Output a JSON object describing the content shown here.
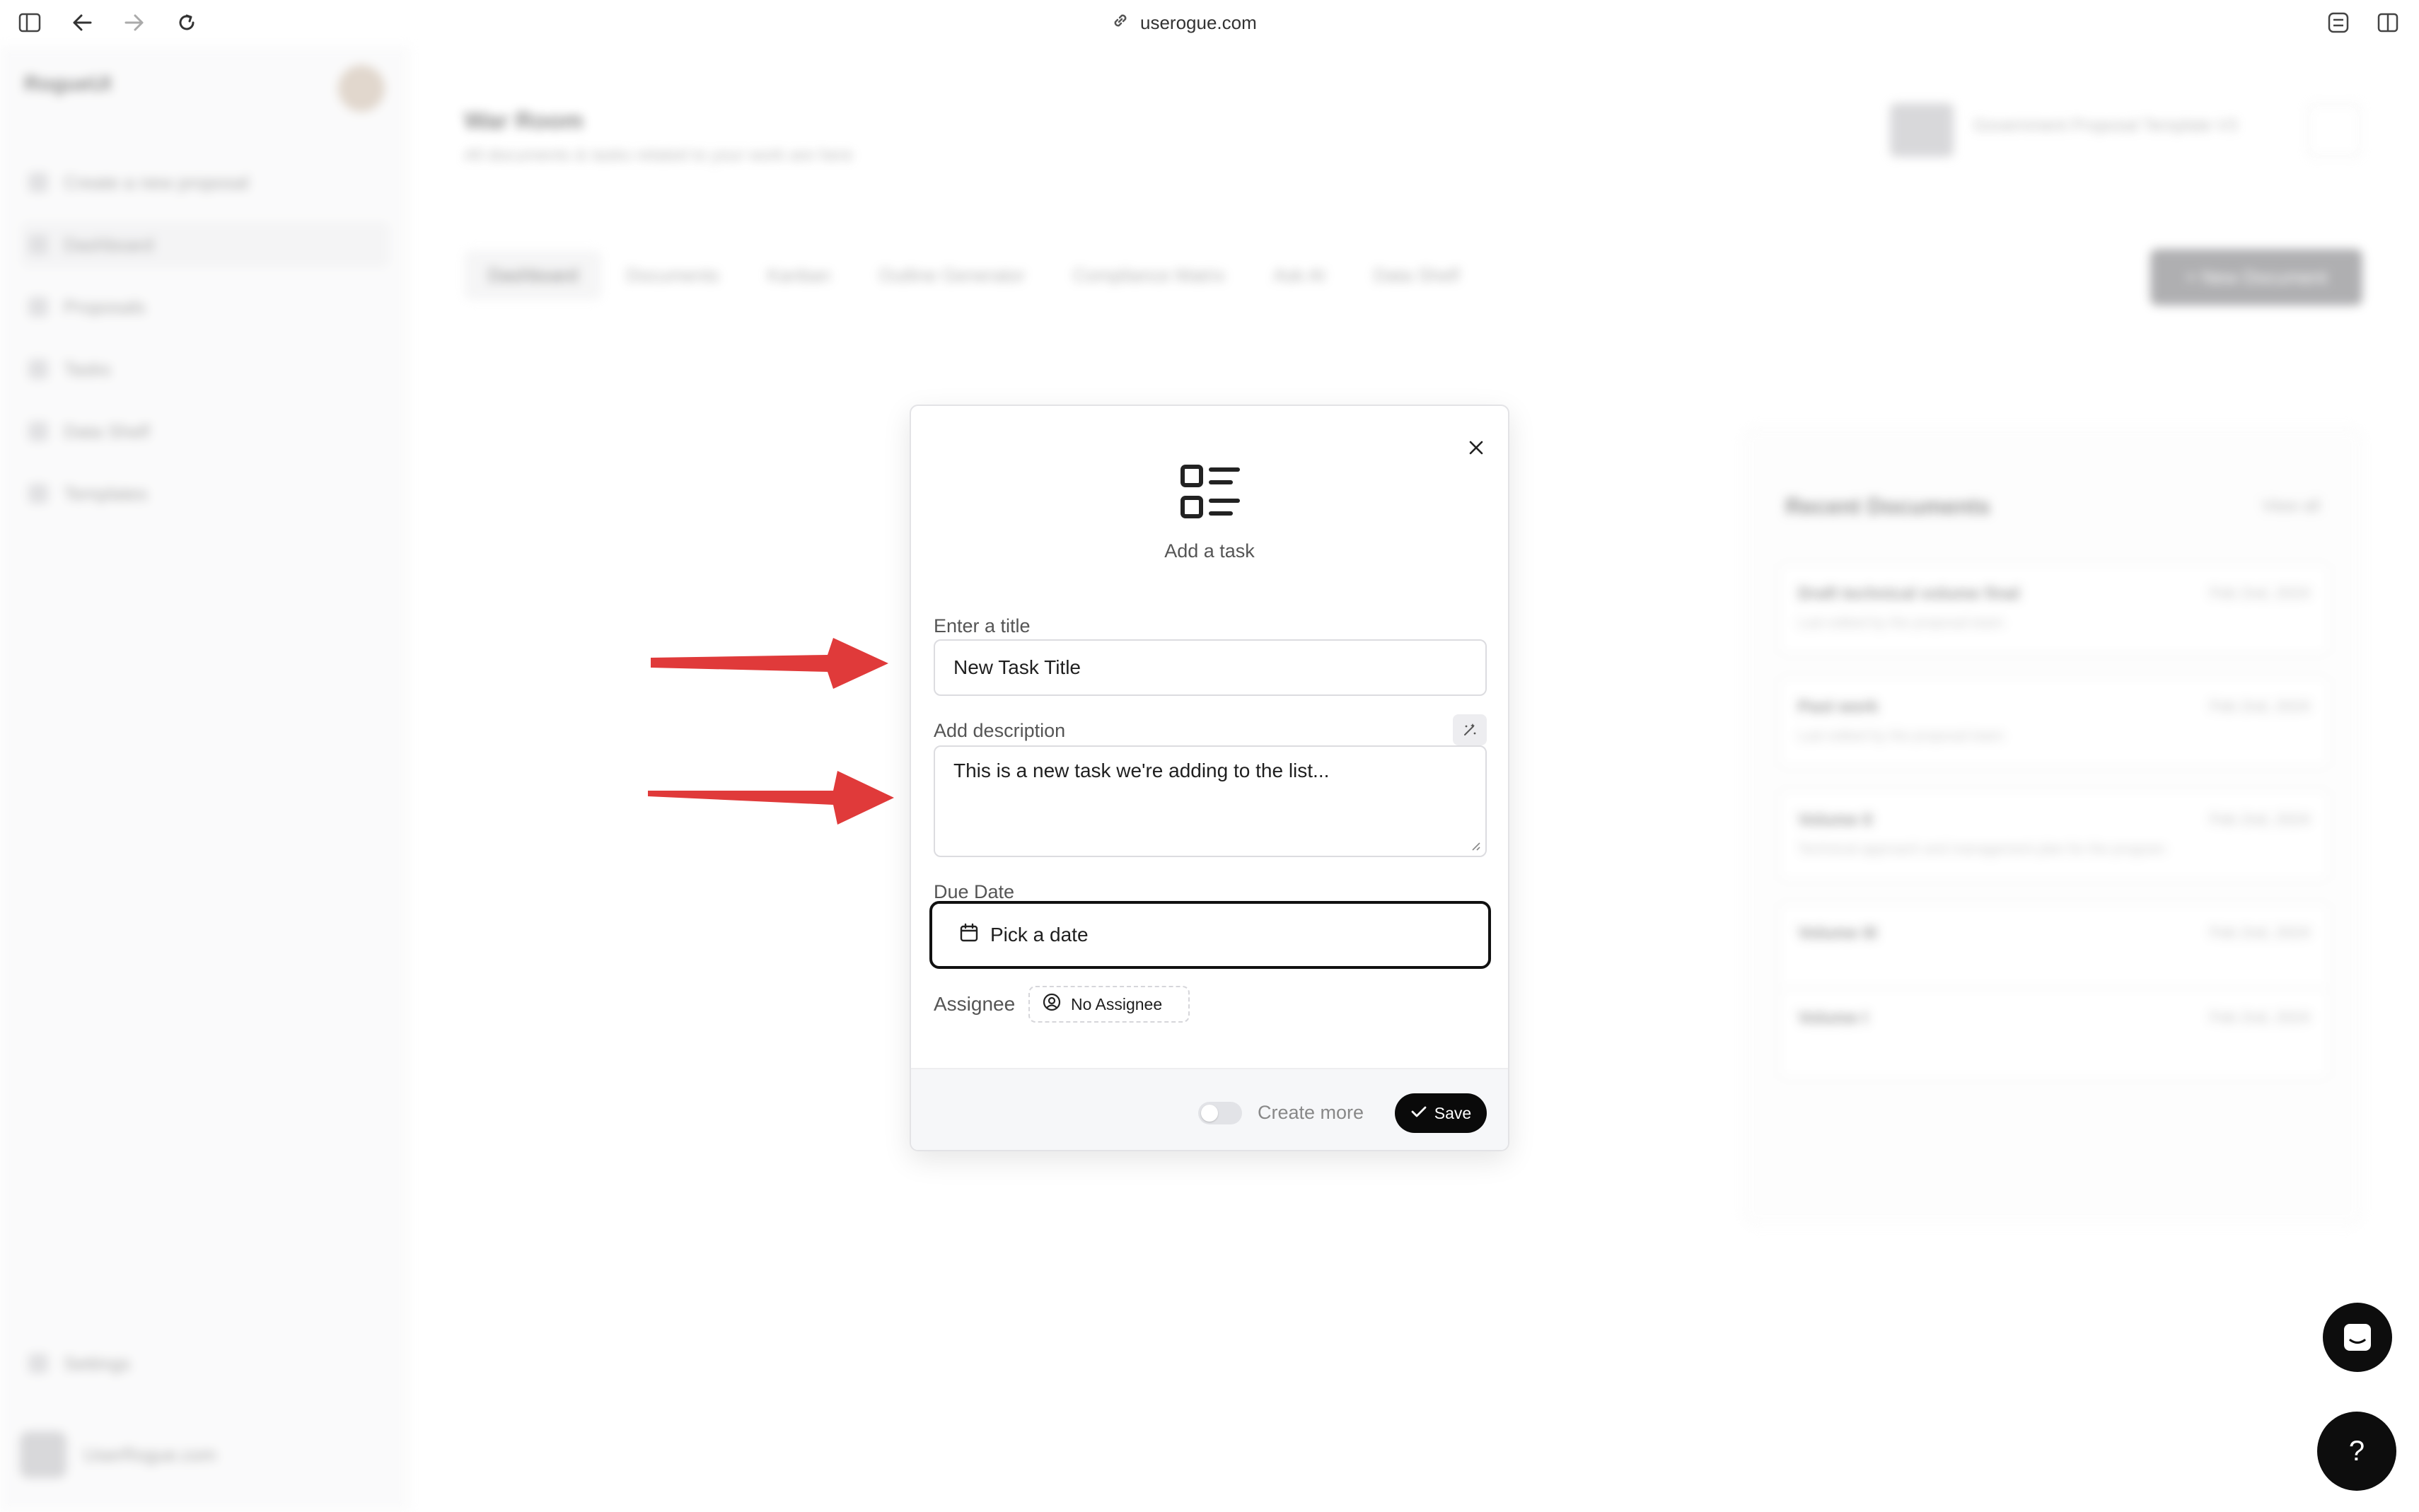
{
  "browser": {
    "url": "userogue.com"
  },
  "background": {
    "logo": "RogueUI",
    "sidebar_items": [
      {
        "label": "Create a new proposal"
      },
      {
        "label": "Dashboard"
      },
      {
        "label": "Proposals"
      },
      {
        "label": "Tasks"
      },
      {
        "label": "Data Shelf"
      },
      {
        "label": "Templates"
      }
    ],
    "settings_label": "Settings",
    "user_label": "UserRogue.com",
    "page_title": "War Room",
    "page_subtitle": "All documents & tasks related to your work are here",
    "tabs": [
      "Dashboard",
      "Documents",
      "Kanban",
      "Outline Generator",
      "Compliance Matrix",
      "Ask AI",
      "Data Shelf"
    ],
    "new_document": "+ New Document",
    "proposal_selector": "Government Proposal Template V3",
    "recent": {
      "title": "Recent Documents",
      "view_all": "View all",
      "rows": [
        {
          "name": "Draft technical volume final",
          "date": "Feb 2nd, 2024",
          "sub": "Last edited by the proposal team"
        },
        {
          "name": "Past work",
          "date": "Feb 2nd, 2024",
          "sub": "Last edited by the proposal team"
        },
        {
          "name": "Volume II",
          "date": "Feb 2nd, 2024",
          "sub": "Technical approach and management plan for the program"
        },
        {
          "name": "Volume III",
          "date": "Feb 2nd, 2024",
          "sub": ""
        },
        {
          "name": "Volume I",
          "date": "Feb 2nd, 2024",
          "sub": ""
        }
      ]
    }
  },
  "modal": {
    "heading": "Add a task",
    "title_label": "Enter a title",
    "title_value": "New Task Title",
    "description_label": "Add description",
    "description_value": "This is a new task we're adding to the list...",
    "due_date_label": "Due Date",
    "due_date_placeholder": "Pick a date",
    "assignee_label": "Assignee",
    "assignee_value": "No Assignee",
    "create_more_label": "Create more",
    "create_more_enabled": false,
    "save_label": "Save"
  },
  "colors": {
    "arrow": "#e03a3a",
    "primary": "#0a0a0a",
    "focus_border": "#111111"
  },
  "icons": {
    "sidebar_toggle": "sidebar-icon",
    "back": "arrow-left-icon",
    "forward": "arrow-right-icon",
    "reload": "reload-icon",
    "link": "link-icon",
    "close": "close-icon",
    "task": "task-list-icon",
    "calendar": "calendar-icon",
    "user": "user-circle-icon",
    "check": "check-icon",
    "chat": "chat-icon",
    "help": "?"
  }
}
